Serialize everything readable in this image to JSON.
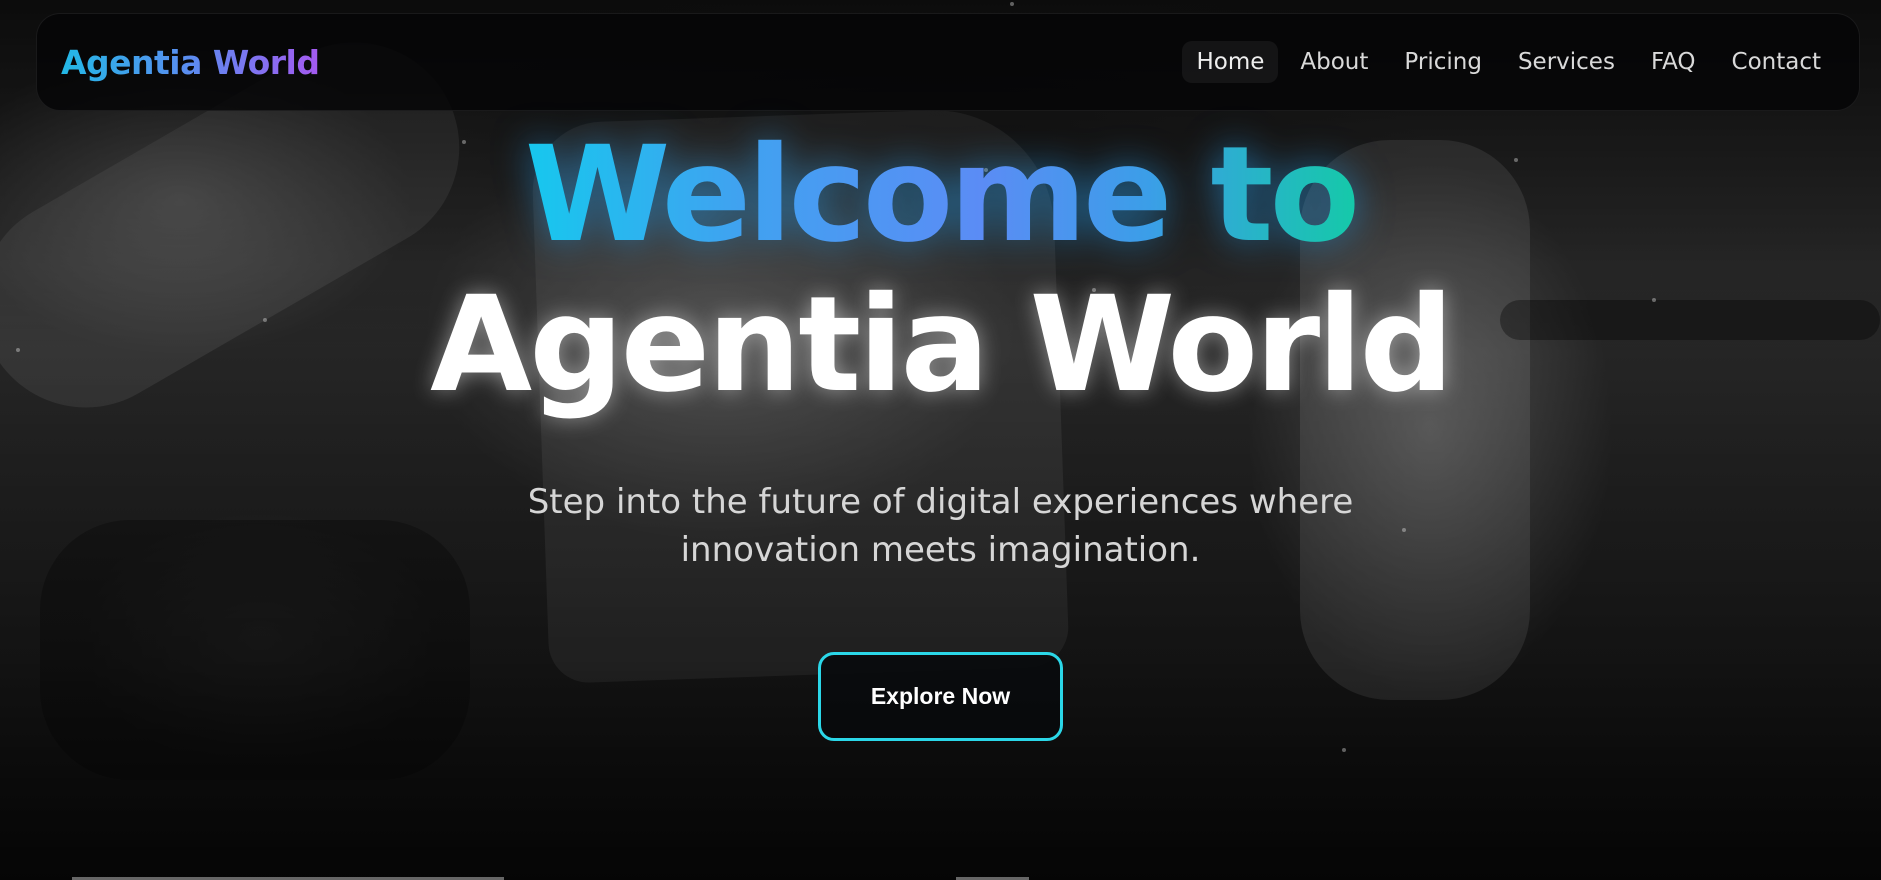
{
  "navbar": {
    "logo": "Agentia World",
    "links": [
      {
        "label": "Home",
        "active": true
      },
      {
        "label": "About"
      },
      {
        "label": "Pricing"
      },
      {
        "label": "Services"
      },
      {
        "label": "FAQ"
      },
      {
        "label": "Contact"
      }
    ]
  },
  "hero": {
    "title_line1": "Welcome to",
    "title_line2": "Agentia World",
    "subtitle": "Step into the future of digital experiences where innovation meets imagination.",
    "cta_label": "Explore Now"
  },
  "colors": {
    "accent_cyan": "#2bd7e8",
    "gradient_start": "#16c8ee",
    "gradient_mid": "#5b8cf5",
    "gradient_end": "#15c9a9",
    "logo_purple": "#a45af0"
  }
}
